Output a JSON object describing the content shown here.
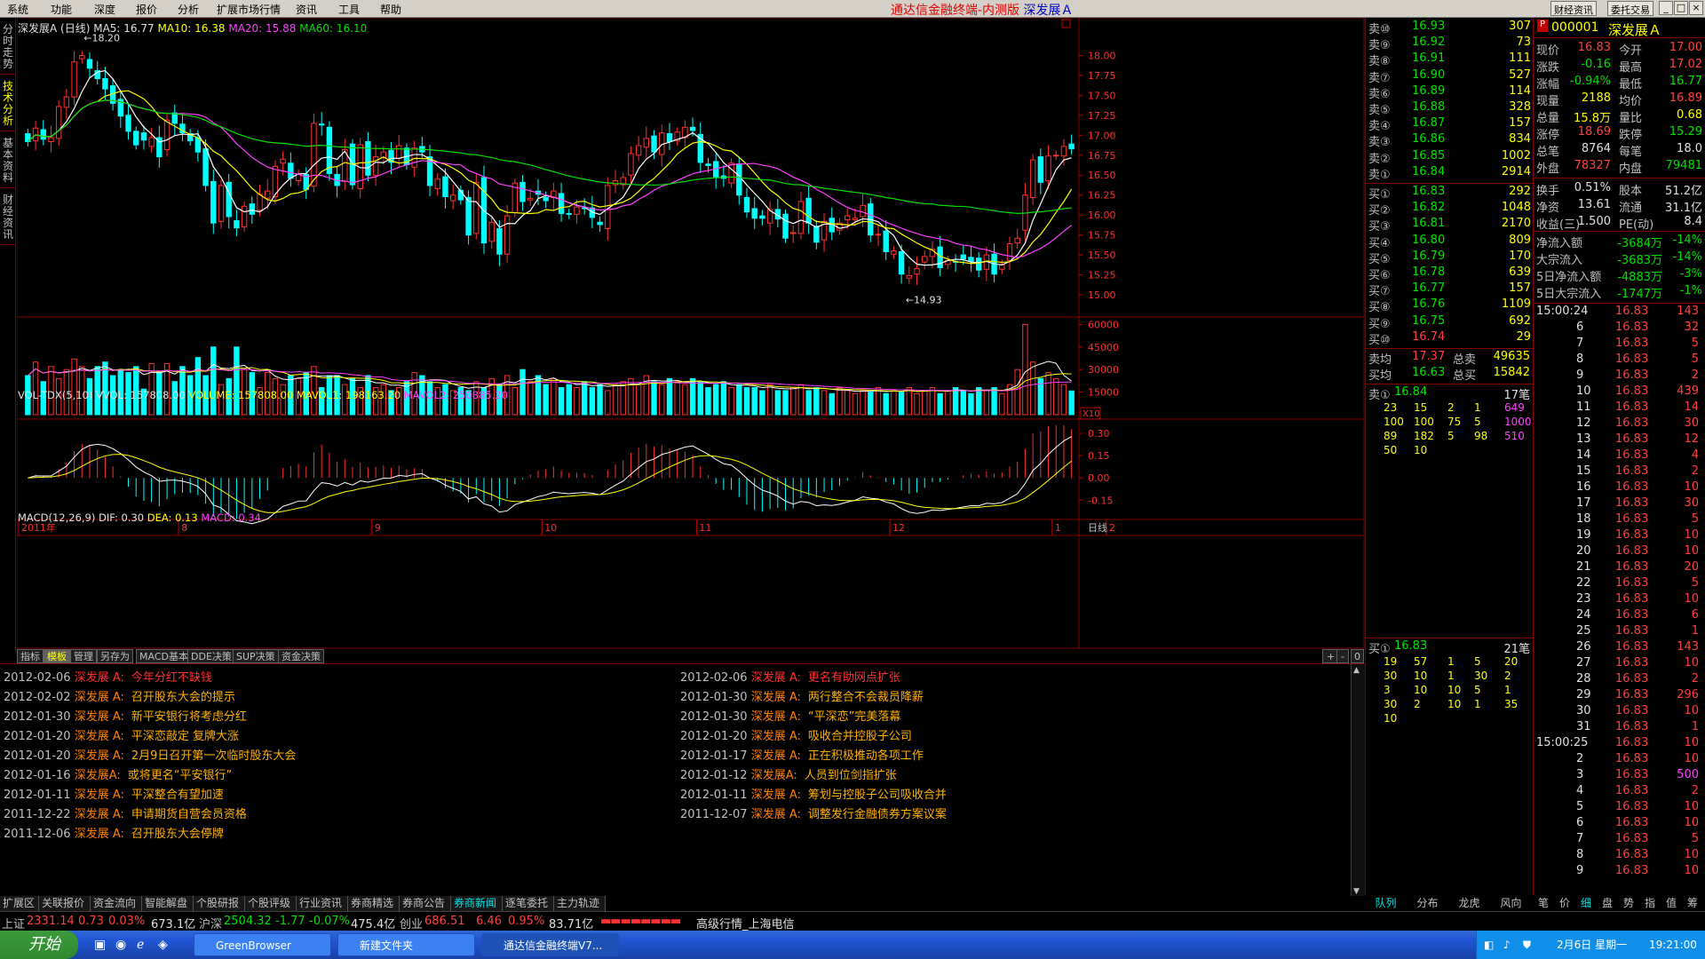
{
  "menubar": {
    "items": [
      "系统",
      "功能",
      "深度",
      "报价",
      "分析",
      "扩展市场行情",
      "资讯",
      "工具",
      "帮助"
    ],
    "title_main": "通达信金融终端-内测版",
    "title_stock": "深发展Ａ",
    "btn_news": "财经资讯",
    "btn_trade": "委托交易",
    "win_min": "_",
    "win_max": "□",
    "win_close": "×"
  },
  "left_tabs": [
    "分时走势",
    "技术分析",
    "基本资料",
    "财经资讯"
  ],
  "chart": {
    "header_name": "深发展A (日线)",
    "ma5": "MA5: 16.77",
    "ma10": "MA10: 16.38",
    "ma20": "MA20: 15.88",
    "ma60": "MA60: 16.10",
    "price_ticks": [
      "18.00",
      "17.75",
      "17.50",
      "17.25",
      "17.00",
      "16.75",
      "16.50",
      "16.25",
      "16.00",
      "15.75",
      "15.50",
      "15.25",
      "15.00"
    ],
    "high_label": "18.20",
    "low_label": "14.93",
    "vol_header": "VOL-TDX(5,10)",
    "vvol": "VVOL: 157808.00",
    "volume": "VOLUME: 157808.00",
    "mavol1": "MAVOL1: 198163.20",
    "mavol2": "MAVOL2: 250885.20",
    "vol_ticks": [
      "60000",
      "45000",
      "30000",
      "15000"
    ],
    "vol_unit": "X10",
    "macd_header": "MACD(12,26,9)",
    "dif": "DIF: 0.30",
    "dea": "DEA: 0.13",
    "macd": "MACD: 0.34",
    "macd_ticks": [
      "0.30",
      "0.15",
      "0.00",
      "-0.15"
    ],
    "date_labels": [
      "2011年",
      "8",
      "9",
      "10",
      "11",
      "12",
      "1",
      "2"
    ],
    "period": "日线",
    "colors": {
      "up": "#ff3030",
      "down": "#00ffff",
      "ma5": "#ffffff",
      "ma10": "#ffff00",
      "ma20": "#ff40ff",
      "ma60": "#00e000",
      "grid": "#800000"
    }
  },
  "chart_data": {
    "type": "candlestick",
    "open": [
      17.02,
      16.93,
      17.07,
      16.92,
      16.96,
      17.35,
      17.48,
      17.96,
      17.95,
      17.81,
      17.71,
      17.62,
      17.45,
      17.25,
      17.05,
      17.03,
      16.86,
      16.97,
      16.82,
      17.28,
      17.14,
      17.02,
      16.97,
      16.83,
      16.42,
      15.92,
      16.41,
      15.93,
      15.85,
      16.14,
      16.06,
      16.21,
      16.23,
      16.65,
      16.65,
      16.43,
      16.51,
      16.36,
      17.14,
      17.1,
      16.51,
      16.42,
      16.89,
      16.33,
      16.92,
      16.5,
      16.72,
      16.81,
      16.71,
      16.84,
      16.6,
      16.86,
      16.73,
      16.33,
      16.48,
      16.18,
      16.31,
      16.22,
      15.77,
      16.47,
      15.67,
      15.83,
      15.51,
      16.03,
      16.41,
      16.19,
      16.3,
      16.22,
      16.22,
      16.27,
      16.02,
      16.01,
      16.09,
      16.09,
      15.91,
      15.83,
      16.38,
      16.38,
      16.5,
      16.75,
      16.85,
      16.99,
      16.76,
      17.02,
      16.93,
      16.97,
      17.1,
      17.01,
      16.64,
      16.67,
      16.49,
      16.4,
      16.64,
      16.22,
      16.08,
      15.99,
      15.9,
      16.07,
      16.01,
      15.77,
      15.77,
      16.21,
      15.86,
      15.69,
      15.96,
      15.81,
      15.94,
      15.94,
      15.98,
      16.14,
      15.76,
      15.8,
      15.51,
      15.54,
      15.21,
      15.26,
      15.41,
      15.48,
      15.6,
      15.38,
      15.42,
      15.5,
      15.47,
      15.46,
      15.32,
      15.51,
      15.32,
      15.43,
      15.65,
      15.81,
      16.22,
      16.73,
      16.43,
      16.75,
      16.74,
      16.89
    ],
    "close": [
      16.92,
      17.09,
      16.95,
      16.97,
      17.36,
      17.48,
      17.92,
      18.0,
      17.84,
      17.71,
      17.58,
      17.4,
      17.24,
      17.05,
      16.88,
      16.94,
      16.97,
      16.73,
      17.19,
      17.15,
      17.03,
      16.93,
      16.79,
      16.37,
      15.9,
      16.37,
      15.98,
      15.84,
      16.11,
      16.01,
      16.26,
      16.3,
      16.61,
      16.7,
      16.46,
      16.51,
      16.32,
      17.15,
      17.13,
      16.52,
      16.37,
      16.82,
      16.38,
      16.88,
      16.5,
      16.73,
      16.79,
      16.66,
      16.87,
      16.63,
      16.84,
      16.79,
      16.37,
      16.45,
      16.23,
      16.25,
      16.19,
      15.75,
      16.41,
      15.65,
      15.91,
      15.51,
      15.99,
      16.4,
      16.17,
      16.21,
      16.26,
      16.18,
      16.3,
      16.02,
      16.01,
      16.1,
      16.08,
      15.97,
      15.88,
      16.37,
      16.43,
      16.47,
      16.77,
      16.87,
      16.96,
      16.79,
      17.03,
      16.92,
      17.04,
      17.1,
      17.06,
      16.66,
      16.62,
      16.48,
      16.46,
      16.65,
      16.25,
      16.04,
      15.96,
      15.96,
      16.07,
      15.95,
      15.71,
      15.78,
      16.17,
      15.9,
      15.66,
      15.92,
      15.79,
      15.9,
      15.99,
      15.96,
      16.12,
      15.75,
      15.76,
      15.54,
      15.55,
      15.26,
      15.24,
      15.33,
      15.48,
      15.57,
      15.34,
      15.43,
      15.41,
      15.45,
      15.42,
      15.31,
      15.5,
      15.26,
      15.38,
      15.64,
      15.71,
      16.25,
      16.69,
      16.41,
      16.74,
      16.75,
      16.86,
      16.83
    ],
    "vol": [
      26000,
      35000,
      22000,
      32000,
      24000,
      30000,
      37000,
      32000,
      24000,
      32000,
      35000,
      26000,
      30000,
      28000,
      32000,
      17000,
      34000,
      28000,
      34000,
      22000,
      32000,
      26000,
      38000,
      26000,
      45000,
      20000,
      24000,
      45000,
      30000,
      28000,
      18000,
      28000,
      24000,
      20000,
      26000,
      24000,
      28000,
      32000,
      18000,
      26000,
      26000,
      20000,
      24000,
      18000,
      26000,
      18000,
      20000,
      16000,
      18000,
      22000,
      28000,
      26000,
      22000,
      18000,
      20000,
      16000,
      18000,
      16000,
      22000,
      18000,
      24000,
      20000,
      26000,
      18000,
      30000,
      22000,
      26000,
      20000,
      24000,
      18000,
      20000,
      18000,
      22000,
      18000,
      20000,
      16000,
      20000,
      22000,
      24000,
      20000,
      26000,
      22000,
      20000,
      24000,
      22000,
      20000,
      24000,
      22000,
      18000,
      20000,
      22000,
      18000,
      20000,
      18000,
      18000,
      16000,
      20000,
      16000,
      16000,
      18000,
      20000,
      16000,
      18000,
      16000,
      14000,
      18000,
      16000,
      14000,
      16000,
      15000,
      18000,
      14000,
      16000,
      15000,
      18000,
      14000,
      16000,
      18000,
      14000,
      16000,
      18000,
      16000,
      14000,
      18000,
      16000,
      18000,
      14000,
      20000,
      30000,
      60000,
      35000,
      24000,
      28000,
      24000,
      20000,
      15800
    ],
    "xlabels": [
      "2011年",
      "8",
      "9",
      "10",
      "11",
      "12",
      "1",
      "2"
    ],
    "ylim": [
      14.8,
      18.25
    ]
  },
  "right_panel": {
    "stock_code": "000001",
    "stock_name": "深发展Ａ",
    "sell": [
      {
        "l": "卖⑩",
        "p": "16.93",
        "v": "307"
      },
      {
        "l": "卖⑨",
        "p": "16.92",
        "v": "73"
      },
      {
        "l": "卖⑧",
        "p": "16.91",
        "v": "111"
      },
      {
        "l": "卖⑦",
        "p": "16.90",
        "v": "527"
      },
      {
        "l": "卖⑥",
        "p": "16.89",
        "v": "114"
      },
      {
        "l": "卖⑤",
        "p": "16.88",
        "v": "328"
      },
      {
        "l": "卖④",
        "p": "16.87",
        "v": "157"
      },
      {
        "l": "卖③",
        "p": "16.86",
        "v": "834"
      },
      {
        "l": "卖②",
        "p": "16.85",
        "v": "1002"
      },
      {
        "l": "卖①",
        "p": "16.84",
        "v": "2914"
      }
    ],
    "buy": [
      {
        "l": "买①",
        "p": "16.83",
        "v": "292"
      },
      {
        "l": "买②",
        "p": "16.82",
        "v": "1048"
      },
      {
        "l": "买③",
        "p": "16.81",
        "v": "2170"
      },
      {
        "l": "买④",
        "p": "16.80",
        "v": "809"
      },
      {
        "l": "买⑤",
        "p": "16.79",
        "v": "170"
      },
      {
        "l": "买⑥",
        "p": "16.78",
        "v": "639"
      },
      {
        "l": "买⑦",
        "p": "16.77",
        "v": "157"
      },
      {
        "l": "买⑧",
        "p": "16.76",
        "v": "1109"
      },
      {
        "l": "买⑨",
        "p": "16.75",
        "v": "692"
      },
      {
        "l": "买⑩",
        "p": "16.74",
        "v": "29"
      }
    ],
    "avg_sell_l": "卖均",
    "avg_sell": "17.37",
    "total_sell_l": "总卖",
    "total_sell": "49635",
    "avg_buy_l": "买均",
    "avg_buy": "16.63",
    "total_buy_l": "总买",
    "total_buy": "15842",
    "s1_l": "卖①",
    "s1_p": "16.84",
    "s1_n": "17笔",
    "s1_grid": [
      [
        "23",
        "15",
        "2",
        "1",
        "649"
      ],
      [
        "100",
        "100",
        "75",
        "5",
        "1000"
      ],
      [
        "89",
        "182",
        "5",
        "98",
        "510"
      ],
      [
        "50",
        "10",
        "",
        "",
        ""
      ]
    ],
    "b1_l": "买①",
    "b1_p": "16.83",
    "b1_n": "21笔",
    "b1_grid": [
      [
        "19",
        "57",
        "1",
        "5",
        "20"
      ],
      [
        "30",
        "10",
        "1",
        "30",
        "2"
      ],
      [
        "3",
        "10",
        "10",
        "5",
        "1"
      ],
      [
        "30",
        "2",
        "10",
        "1",
        "35"
      ],
      [
        "10",
        "",
        "",
        "",
        ""
      ]
    ],
    "quote": [
      {
        "a": "现价",
        "av": "16.83",
        "b": "今开",
        "bv": "17.00",
        "ac": "red",
        "bc": "red"
      },
      {
        "a": "涨跌",
        "av": "-0.16",
        "b": "最高",
        "bv": "17.02",
        "ac": "grn",
        "bc": "red"
      },
      {
        "a": "涨幅",
        "av": "-0.94%",
        "b": "最低",
        "bv": "16.77",
        "ac": "grn",
        "bc": "grn"
      },
      {
        "a": "现量",
        "av": "2188",
        "b": "均价",
        "bv": "16.89",
        "ac": "yel",
        "bc": "red"
      },
      {
        "a": "总量",
        "av": "15.8万",
        "b": "量比",
        "bv": "0.68",
        "ac": "yel",
        "bc": "yel"
      },
      {
        "a": "涨停",
        "av": "18.69",
        "b": "跌停",
        "bv": "15.29",
        "ac": "red",
        "bc": "grn"
      },
      {
        "a": "总笔",
        "av": "8764",
        "b": "每笔",
        "bv": "18.0",
        "ac": "wht",
        "bc": "wht"
      },
      {
        "a": "外盘",
        "av": "78327",
        "b": "内盘",
        "bv": "79481",
        "ac": "red",
        "bc": "grn"
      },
      {
        "a": "换手",
        "av": "0.51%",
        "b": "股本",
        "bv": "51.2亿",
        "ac": "wht",
        "bc": "wht"
      },
      {
        "a": "净资",
        "av": "13.61",
        "b": "流通",
        "bv": "31.1亿",
        "ac": "wht",
        "bc": "wht"
      },
      {
        "a": "收益(三)",
        "av": "1.500",
        "b": "PE(动)",
        "bv": "8.4",
        "ac": "wht",
        "bc": "wht"
      }
    ],
    "flows": [
      {
        "a": "净流入额",
        "v": "-3684万",
        "p": "-14%"
      },
      {
        "a": "大宗流入",
        "v": "-3683万",
        "p": "-14%"
      },
      {
        "a": "5日净流入额",
        "v": "-4883万",
        "p": "-3%"
      },
      {
        "a": "5日大宗流入",
        "v": "-1747万",
        "p": "-1%"
      }
    ],
    "ticks": [
      {
        "t": "15:00:24",
        "p": "16.83",
        "v": "143",
        "c": "red"
      },
      {
        "t": "6",
        "p": "16.83",
        "v": "32",
        "c": "red"
      },
      {
        "t": "7",
        "p": "16.83",
        "v": "5",
        "c": "red"
      },
      {
        "t": "8",
        "p": "16.83",
        "v": "5",
        "c": "red"
      },
      {
        "t": "9",
        "p": "16.83",
        "v": "2",
        "c": "red"
      },
      {
        "t": "10",
        "p": "16.83",
        "v": "439",
        "c": "red"
      },
      {
        "t": "11",
        "p": "16.83",
        "v": "14",
        "c": "red"
      },
      {
        "t": "12",
        "p": "16.83",
        "v": "30",
        "c": "red"
      },
      {
        "t": "13",
        "p": "16.83",
        "v": "12",
        "c": "red"
      },
      {
        "t": "14",
        "p": "16.83",
        "v": "4",
        "c": "red"
      },
      {
        "t": "15",
        "p": "16.83",
        "v": "2",
        "c": "red"
      },
      {
        "t": "16",
        "p": "16.83",
        "v": "10",
        "c": "red"
      },
      {
        "t": "17",
        "p": "16.83",
        "v": "30",
        "c": "red"
      },
      {
        "t": "18",
        "p": "16.83",
        "v": "5",
        "c": "red"
      },
      {
        "t": "19",
        "p": "16.83",
        "v": "10",
        "c": "red"
      },
      {
        "t": "20",
        "p": "16.83",
        "v": "10",
        "c": "red"
      },
      {
        "t": "21",
        "p": "16.83",
        "v": "20",
        "c": "red"
      },
      {
        "t": "22",
        "p": "16.83",
        "v": "5",
        "c": "red"
      },
      {
        "t": "23",
        "p": "16.83",
        "v": "10",
        "c": "red"
      },
      {
        "t": "24",
        "p": "16.83",
        "v": "6",
        "c": "red"
      },
      {
        "t": "25",
        "p": "16.83",
        "v": "1",
        "c": "red"
      },
      {
        "t": "26",
        "p": "16.83",
        "v": "143",
        "c": "red"
      },
      {
        "t": "27",
        "p": "16.83",
        "v": "10",
        "c": "red"
      },
      {
        "t": "28",
        "p": "16.83",
        "v": "2",
        "c": "red"
      },
      {
        "t": "29",
        "p": "16.83",
        "v": "296",
        "c": "red"
      },
      {
        "t": "30",
        "p": "16.83",
        "v": "10",
        "c": "red"
      },
      {
        "t": "31",
        "p": "16.83",
        "v": "1",
        "c": "red"
      },
      {
        "t": "15:00:25",
        "p": "16.83",
        "v": "10",
        "c": "red"
      },
      {
        "t": "2",
        "p": "16.83",
        "v": "10",
        "c": "red"
      },
      {
        "t": "3",
        "p": "16.83",
        "v": "500",
        "c": "mag"
      },
      {
        "t": "4",
        "p": "16.83",
        "v": "2",
        "c": "red"
      },
      {
        "t": "5",
        "p": "16.83",
        "v": "10",
        "c": "red"
      },
      {
        "t": "6",
        "p": "16.83",
        "v": "10",
        "c": "red"
      },
      {
        "t": "7",
        "p": "16.83",
        "v": "5",
        "c": "red"
      },
      {
        "t": "8",
        "p": "16.83",
        "v": "10",
        "c": "red"
      },
      {
        "t": "9",
        "p": "16.83",
        "v": "10",
        "c": "red"
      }
    ],
    "tabs1": [
      "队列",
      "分布",
      "龙虎",
      "风向"
    ],
    "tabs2": [
      "笔",
      "价",
      "细",
      "盘",
      "势",
      "指",
      "值",
      "筹"
    ]
  },
  "bottom_tabs": [
    "指标",
    "模板",
    "管理",
    "另存为",
    "MACD基本",
    "DDE决策",
    "SUP决策",
    "资金决策"
  ],
  "news_left": [
    {
      "d": "2012-02-06",
      "s": "深发展 A:",
      "t": "今年分红不缺钱",
      "hl": true
    },
    {
      "d": "2012-02-02",
      "s": "深发展 A:",
      "t": "召开股东大会的提示",
      "hl": false
    },
    {
      "d": "2012-01-30",
      "s": "深发展 A:",
      "t": "新平安银行将考虑分红",
      "hl": false
    },
    {
      "d": "2012-01-20",
      "s": "深发展 A:",
      "t": "平深恋敲定 复牌大涨",
      "hl": false
    },
    {
      "d": "2012-01-20",
      "s": "深发展 A:",
      "t": "2月9日召开第一次临时股东大会",
      "hl": false
    },
    {
      "d": "2012-01-16",
      "s": "深发展A:",
      "t": "或将更名“平安银行”",
      "hl": false
    },
    {
      "d": "2012-01-11",
      "s": "深发展 A:",
      "t": "平深整合有望加速",
      "hl": false
    },
    {
      "d": "2011-12-22",
      "s": "深发展 A:",
      "t": "申请期货自营会员资格",
      "hl": false
    },
    {
      "d": "2011-12-06",
      "s": "深发展 A:",
      "t": "召开股东大会停牌",
      "hl": false
    }
  ],
  "news_right": [
    {
      "d": "2012-02-06",
      "s": "深发展 A:",
      "t": "更名有助网点扩张",
      "hl": true
    },
    {
      "d": "2012-01-30",
      "s": "深发展 A:",
      "t": "两行整合不会裁员降薪",
      "hl": false
    },
    {
      "d": "2012-01-30",
      "s": "深发展 A:",
      "t": "“平深恋”完美落幕",
      "hl": false
    },
    {
      "d": "2012-01-20",
      "s": "深发展 A:",
      "t": "吸收合并控股子公司",
      "hl": false
    },
    {
      "d": "2012-01-17",
      "s": "深发展 A:",
      "t": "正在积极推动各项工作",
      "hl": false
    },
    {
      "d": "2012-01-12",
      "s": "深发展A:",
      "t": "人员到位剑指扩张",
      "hl": false
    },
    {
      "d": "2012-01-11",
      "s": "深发展 A:",
      "t": "筹划与控股子公司吸收合并",
      "hl": false
    },
    {
      "d": "2011-12-07",
      "s": "深发展 A:",
      "t": "调整发行金融债券方案议案",
      "hl": false
    }
  ],
  "func_tabs": [
    "扩展区",
    "关联报价",
    "资金流向",
    "智能解盘",
    "个股研报",
    "个股评级",
    "行业资讯",
    "券商精选",
    "券商公告",
    "券商新闻",
    "逐笔委托",
    "主力轨迹"
  ],
  "index_bar": {
    "sh_l": "上证",
    "sh": "2331.14",
    "sh_c": "0.73",
    "sh_p": "0.03%",
    "sh_a": "673.1亿",
    "hs_l": "沪深",
    "hs": "2504.32",
    "hs_c": "-1.77",
    "hs_p": "-0.07%",
    "hs_a": "475.4亿",
    "cy_l": "创业",
    "cy": "686.51",
    "cy_c": "6.46",
    "cy_p": "0.95%",
    "cy_a": "83.71亿",
    "server": "高级行情_上海电信"
  },
  "taskbar": {
    "start": "开始",
    "tasks": [
      "GreenBrowser",
      "新建文件夹",
      "通达信金融终端V7..."
    ],
    "date": "2月6日 星期一",
    "time": "19:21:00"
  }
}
